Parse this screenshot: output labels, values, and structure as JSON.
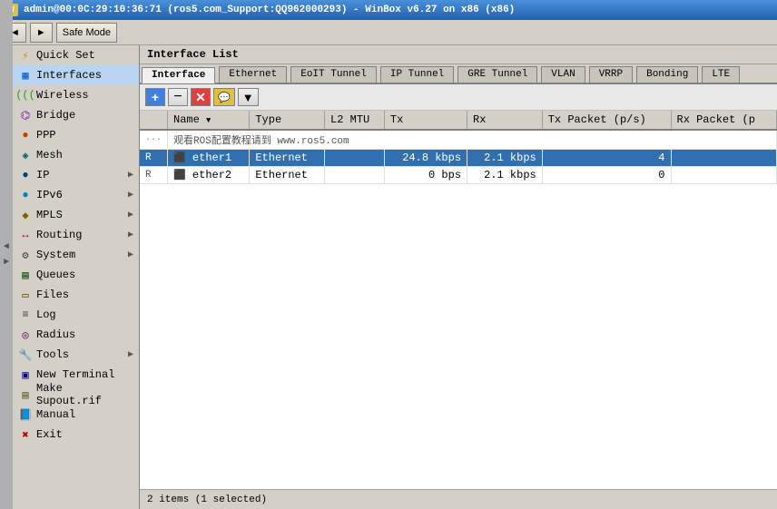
{
  "titlebar": {
    "text": "admin@00:0C:29:10:36:71 (ros5.com_Support:QQ962000293) - WinBox v6.27 on x86 (x86)"
  },
  "toolbar": {
    "back_label": "◄",
    "forward_label": "►",
    "safe_mode_label": "Safe Mode"
  },
  "sidebar": {
    "items": [
      {
        "id": "quick-set",
        "label": "Quick Set",
        "icon": "⚡",
        "has_arrow": false
      },
      {
        "id": "interfaces",
        "label": "Interfaces",
        "icon": "🔌",
        "has_arrow": false,
        "active": true
      },
      {
        "id": "wireless",
        "label": "Wireless",
        "icon": "📡",
        "has_arrow": false
      },
      {
        "id": "bridge",
        "label": "Bridge",
        "icon": "🌉",
        "has_arrow": false
      },
      {
        "id": "ppp",
        "label": "PPP",
        "icon": "🔗",
        "has_arrow": false
      },
      {
        "id": "mesh",
        "label": "Mesh",
        "icon": "◈",
        "has_arrow": false
      },
      {
        "id": "ip",
        "label": "IP",
        "icon": "●",
        "has_arrow": true
      },
      {
        "id": "ipv6",
        "label": "IPv6",
        "icon": "●",
        "has_arrow": true
      },
      {
        "id": "mpls",
        "label": "MPLS",
        "icon": "◆",
        "has_arrow": true
      },
      {
        "id": "routing",
        "label": "Routing",
        "icon": "↔",
        "has_arrow": true
      },
      {
        "id": "system",
        "label": "System",
        "icon": "⚙",
        "has_arrow": true
      },
      {
        "id": "queues",
        "label": "Queues",
        "icon": "▤",
        "has_arrow": false
      },
      {
        "id": "files",
        "label": "Files",
        "icon": "📁",
        "has_arrow": false
      },
      {
        "id": "log",
        "label": "Log",
        "icon": "📄",
        "has_arrow": false
      },
      {
        "id": "radius",
        "label": "Radius",
        "icon": "◎",
        "has_arrow": false
      },
      {
        "id": "tools",
        "label": "Tools",
        "icon": "🔧",
        "has_arrow": true
      },
      {
        "id": "new-terminal",
        "label": "New Terminal",
        "icon": "▣",
        "has_arrow": false
      },
      {
        "id": "make-supout",
        "label": "Make Supout.rif",
        "icon": "📋",
        "has_arrow": false
      },
      {
        "id": "manual",
        "label": "Manual",
        "icon": "📘",
        "has_arrow": false
      },
      {
        "id": "exit",
        "label": "Exit",
        "icon": "✖",
        "has_arrow": false
      }
    ]
  },
  "panel": {
    "title": "Interface List"
  },
  "tabs": [
    {
      "id": "interface",
      "label": "Interface",
      "active": true
    },
    {
      "id": "ethernet",
      "label": "Ethernet"
    },
    {
      "id": "eoit-tunnel",
      "label": "EoIT Tunnel"
    },
    {
      "id": "ip-tunnel",
      "label": "IP Tunnel"
    },
    {
      "id": "gre-tunnel",
      "label": "GRE Tunnel"
    },
    {
      "id": "vlan",
      "label": "VLAN"
    },
    {
      "id": "vrrp",
      "label": "VRRP"
    },
    {
      "id": "bonding",
      "label": "Bonding"
    },
    {
      "id": "lte",
      "label": "LTE"
    }
  ],
  "action_buttons": [
    {
      "id": "add",
      "label": "+",
      "type": "blue"
    },
    {
      "id": "remove",
      "label": "−",
      "type": "normal"
    },
    {
      "id": "mark",
      "label": "✕",
      "type": "red"
    },
    {
      "id": "comment",
      "label": "💬",
      "type": "yellow"
    },
    {
      "id": "filter",
      "label": "▼",
      "type": "normal"
    }
  ],
  "table": {
    "columns": [
      {
        "id": "indicator",
        "label": ""
      },
      {
        "id": "name",
        "label": "Name",
        "sortable": true
      },
      {
        "id": "type",
        "label": "Type"
      },
      {
        "id": "l2mtu",
        "label": "L2 MTU"
      },
      {
        "id": "tx",
        "label": "Tx"
      },
      {
        "id": "rx",
        "label": "Rx"
      },
      {
        "id": "tx-packet",
        "label": "Tx Packet (p/s)"
      },
      {
        "id": "rx-packet",
        "label": "Rx Packet (p"
      }
    ],
    "announce_row": {
      "text": "观看ROS配置教程请到 www.ros5.com"
    },
    "rows": [
      {
        "id": "ether1",
        "indicator": "R",
        "name": "ether1",
        "type": "Ethernet",
        "l2mtu": "",
        "tx": "24.8 kbps",
        "rx": "2.1 kbps",
        "tx_packet": "4",
        "rx_packet": "",
        "selected": true
      },
      {
        "id": "ether2",
        "indicator": "R",
        "name": "ether2",
        "type": "Ethernet",
        "l2mtu": "",
        "tx": "0 bps",
        "rx": "2.1 kbps",
        "tx_packet": "0",
        "rx_packet": "",
        "selected": false
      }
    ]
  },
  "status_bar": {
    "text": "2 items (1 selected)"
  }
}
